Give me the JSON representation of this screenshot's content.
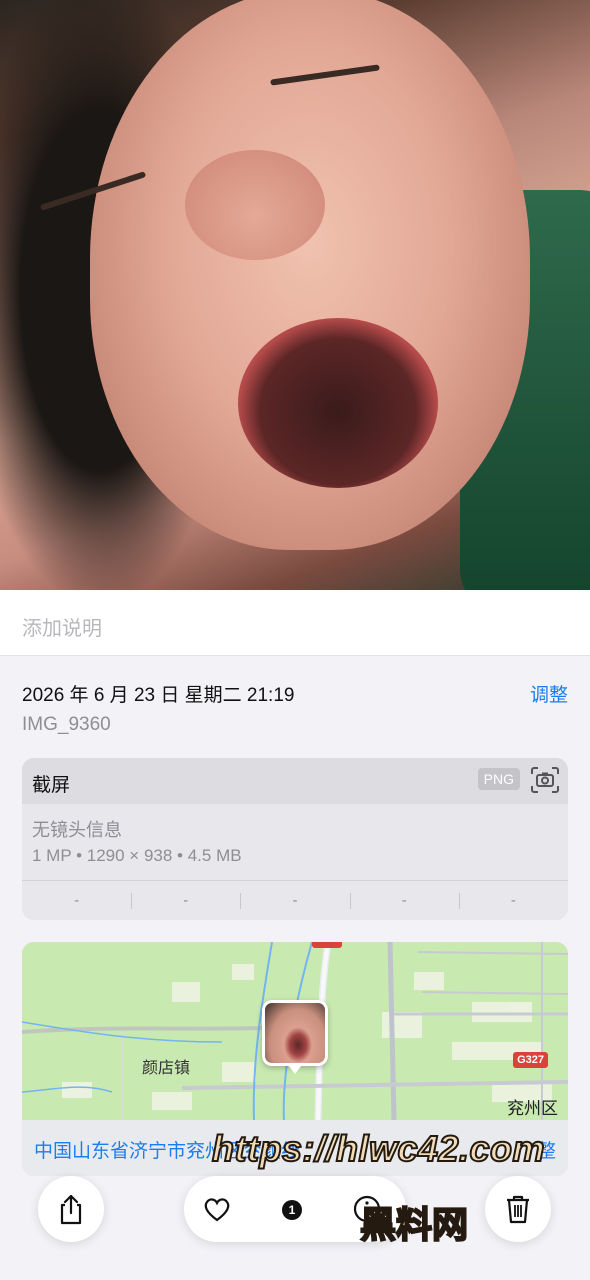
{
  "caption": {
    "placeholder": "添加说明"
  },
  "info": {
    "datetime": "2026 年 6 月 23 日 星期二 21:19",
    "adjust_label": "调整",
    "filename": "IMG_9360"
  },
  "metadata_card": {
    "title": "截屏",
    "format_badge": "PNG",
    "lens": "无镜头信息",
    "specs": "1 MP • 1290 × 938 • 4.5 MB",
    "exif": [
      "-",
      "-",
      "-",
      "-",
      "-"
    ]
  },
  "map": {
    "town_label": "颜店镇",
    "district_label": "兖州区",
    "road_badge": "G327",
    "address": "中国山东省济宁市兖州区兖颜线",
    "edit_label": "整"
  },
  "toolbar": {
    "share_icon": "share-icon",
    "favorite_icon": "heart-icon",
    "count": "1",
    "info_icon": "info-icon",
    "delete_icon": "trash-icon"
  },
  "watermark": {
    "url": "https://hlwc42.com",
    "name": "黑料网"
  }
}
